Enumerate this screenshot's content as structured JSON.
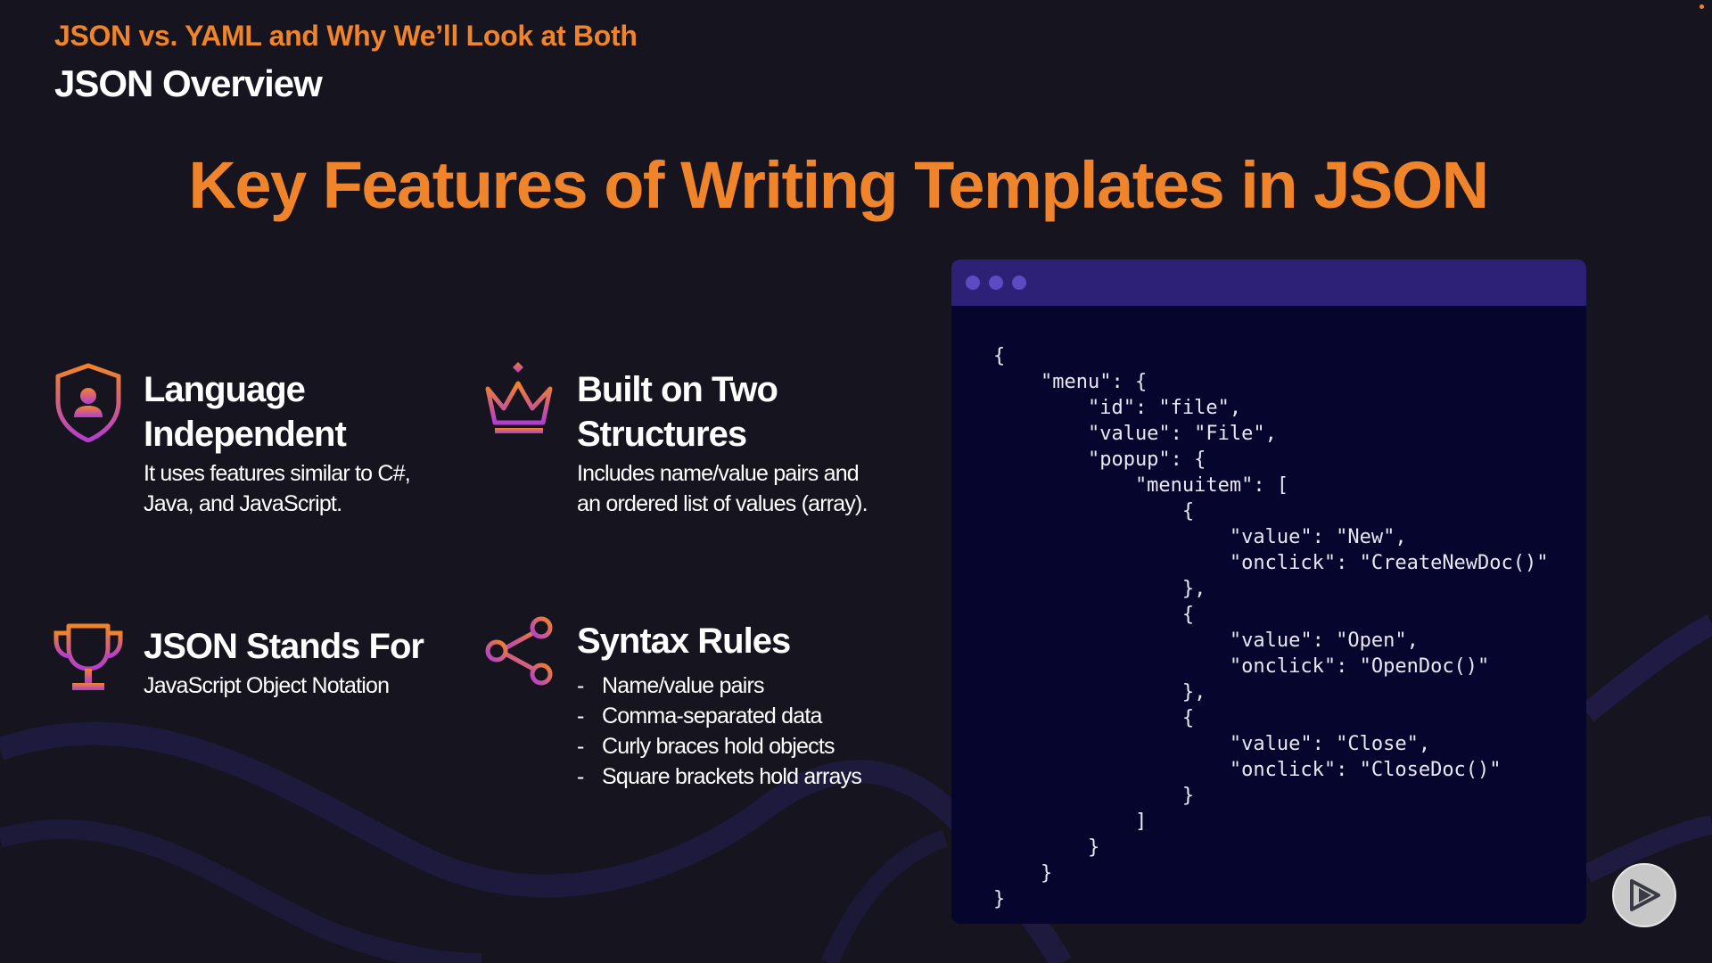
{
  "header": {
    "section_title": "JSON vs. YAML and Why We’ll Look at Both",
    "module_title": "JSON Overview"
  },
  "slide": {
    "title": "Key Features of Writing Templates in JSON"
  },
  "features": {
    "language": {
      "icon": "shield-user-icon",
      "title_line1": "Language",
      "title_line2": "Independent",
      "desc_line1": "It uses features similar to C#,",
      "desc_line2": "Java, and JavaScript."
    },
    "structures": {
      "icon": "crown-icon",
      "title_line1": "Built on Two",
      "title_line2": "Structures",
      "desc_line1": "Includes name/value pairs and",
      "desc_line2": "an ordered list of values (array)."
    },
    "stands_for": {
      "icon": "trophy-icon",
      "title": "JSON Stands For",
      "desc": "JavaScript Object Notation"
    },
    "syntax": {
      "icon": "share-nodes-icon",
      "title": "Syntax Rules",
      "items": [
        "Name/value pairs",
        "Comma-separated data",
        "Curly braces hold objects",
        "Square brackets hold arrays"
      ]
    }
  },
  "code_sample": {
    "text": "{\n    \"menu\": {\n        \"id\": \"file\",\n        \"value\": \"File\",\n        \"popup\": {\n            \"menuitem\": [\n                {\n                    \"value\": \"New\",\n                    \"onclick\": \"CreateNewDoc()\"\n                },\n                {\n                    \"value\": \"Open\",\n                    \"onclick\": \"OpenDoc()\"\n                },\n                {\n                    \"value\": \"Close\",\n                    \"onclick\": \"CloseDoc()\"\n                }\n            ]\n        }\n    }\n}"
  },
  "player": {
    "icon": "play-icon"
  },
  "colors": {
    "background": "#16141f",
    "accent": "#f0842a",
    "code_bg": "#06052d",
    "code_titlebar": "#2c2077",
    "icon_gradient_start": "#f0842a",
    "icon_gradient_end": "#b43dd1"
  }
}
